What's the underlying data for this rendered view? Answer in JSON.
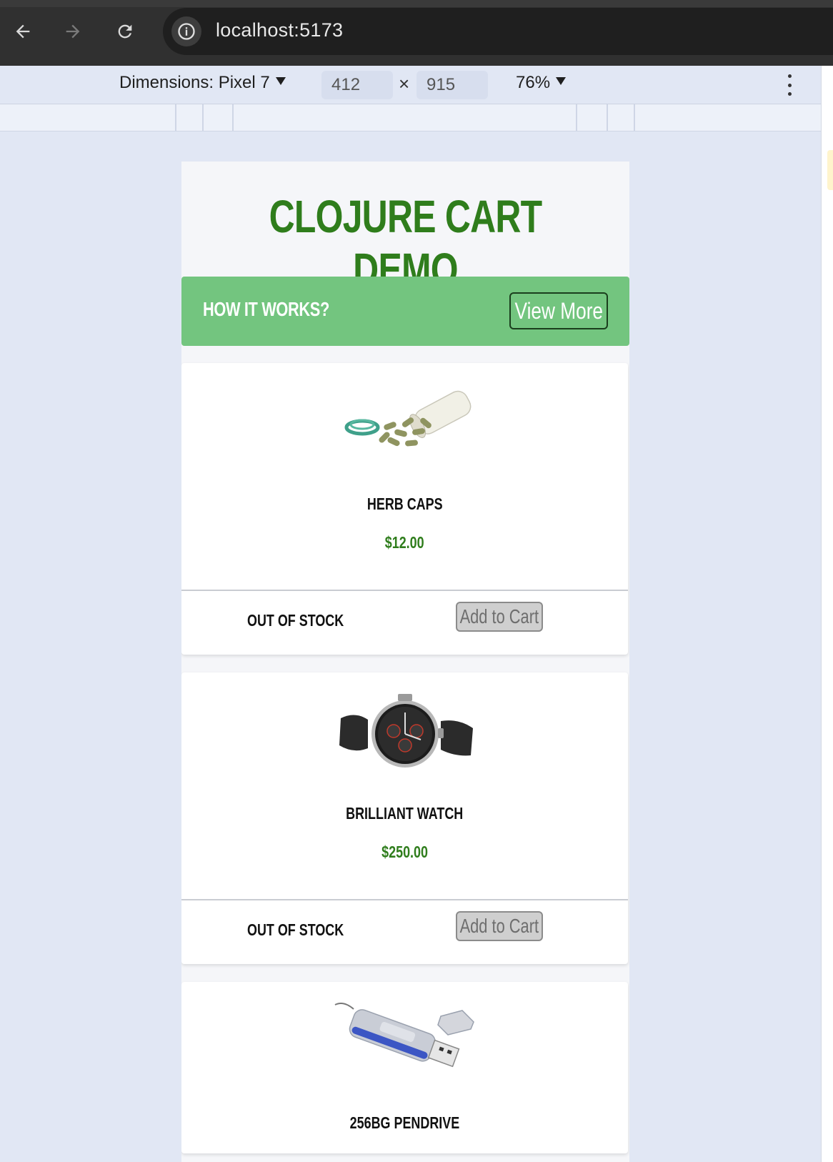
{
  "browser": {
    "url": "localhost:5173",
    "icons": [
      "back-arrow-icon",
      "forward-arrow-icon",
      "reload-icon",
      "info-icon"
    ]
  },
  "devtools": {
    "dimensions_label": "Dimensions: Pixel 7",
    "width": "412",
    "height": "915",
    "times": "×",
    "zoom": "76%"
  },
  "app": {
    "title": "CLOJURE CART DEMO",
    "how_it_works": "HOW IT WORKS?",
    "view_more": "View More",
    "banner_color": "#73c57f",
    "title_color": "#2f7d1c"
  },
  "products": [
    {
      "name": "HERB CAPS",
      "price": "$12.00",
      "stock": "OUT OF STOCK",
      "button": "Add to Cart",
      "image": "herb-caps-image"
    },
    {
      "name": "BRILLIANT WATCH",
      "price": "$250.00",
      "stock": "OUT OF STOCK",
      "button": "Add to Cart",
      "image": "watch-image"
    },
    {
      "name": "256BG PENDRIVE",
      "image": "pendrive-image"
    }
  ]
}
